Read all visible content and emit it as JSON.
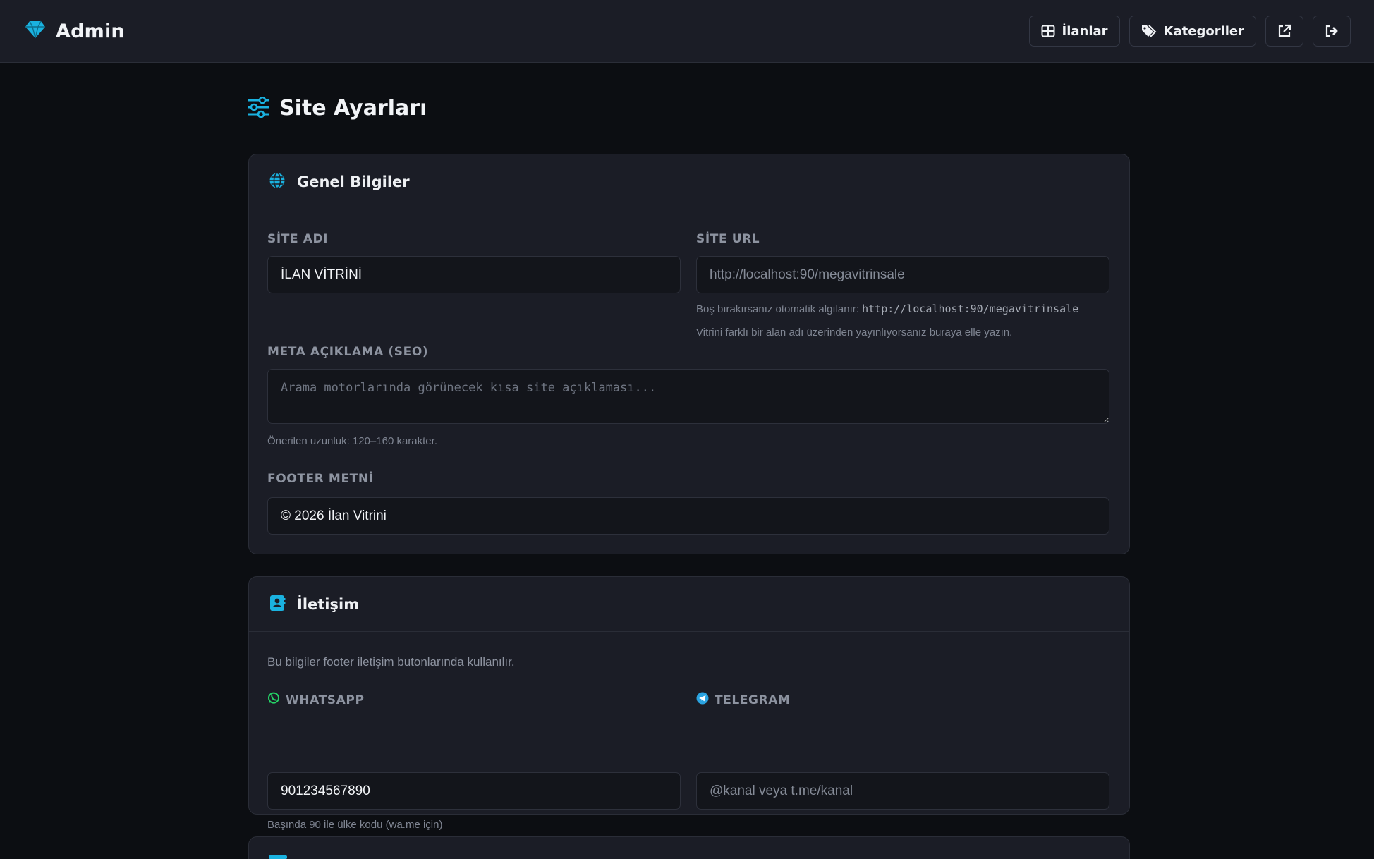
{
  "header": {
    "brand": "Admin",
    "nav": {
      "ilanlar": "İlanlar",
      "kategoriler": "Kategoriler"
    },
    "icons": [
      "diamond-icon",
      "grid-icon",
      "tags-icon",
      "external-link-icon",
      "logout-icon"
    ]
  },
  "page": {
    "title": "Site Ayarları"
  },
  "general": {
    "title": "Genel Bilgiler",
    "site_name_label": "SİTE ADI",
    "site_name_value": "İLAN VİTRİNİ",
    "site_url_label": "SİTE URL",
    "site_url_placeholder": "http://localhost:90/megavitrinsale",
    "site_url_help_prefix": "Boş bırakırsanız otomatik algılanır:",
    "site_url_help_code": "http://localhost:90/megavitrinsale",
    "site_url_help_2": "Vitrini farklı bir alan adı üzerinden yayınlıyorsanız buraya elle yazın.",
    "meta_label": "META AÇIKLAMA (SEO)",
    "meta_placeholder": "Arama motorlarında görünecek kısa site açıklaması...",
    "meta_help": "Önerilen uzunluk: 120–160 karakter.",
    "footer_label": "FOOTER METNİ",
    "footer_value": "© 2026 İlan Vitrini"
  },
  "contact": {
    "title": "İletişim",
    "description": "Bu bilgiler footer iletişim butonlarında kullanılır.",
    "whatsapp_label": "WHATSAPP",
    "whatsapp_value": "901234567890",
    "whatsapp_help": "Başında 90 ile ülke kodu (wa.me için)",
    "telegram_label": "TELEGRAM",
    "telegram_placeholder": "@kanal veya t.me/kanal"
  },
  "colors": {
    "accent": "#1ab2e0",
    "whatsapp": "#25d366",
    "telegram": "#2aa3e0"
  }
}
